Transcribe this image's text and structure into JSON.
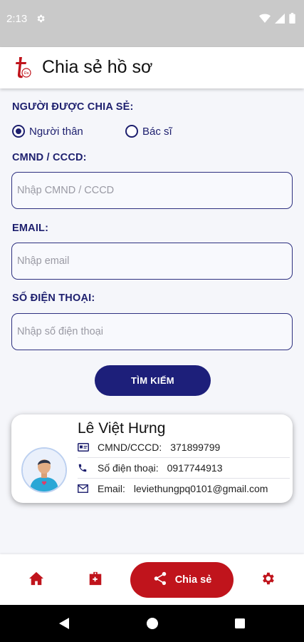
{
  "status_bar": {
    "time": "2:13"
  },
  "header": {
    "title": "Chia sẻ hồ sơ",
    "logo_icon": "hospital-t-logo-icon"
  },
  "form": {
    "share_with_label": "NGƯỜI ĐƯỢC CHIA SẺ:",
    "radio_options": [
      {
        "label": "Người thân",
        "checked": true
      },
      {
        "label": "Bác sĩ",
        "checked": false
      }
    ],
    "id_label": "CMND / CCCD:",
    "id_placeholder": "Nhập CMND / CCCD",
    "id_value": "",
    "email_label": "EMAIL:",
    "email_placeholder": "Nhập email",
    "email_value": "",
    "phone_label": "SỐ ĐIỆN THOẠI:",
    "phone_placeholder": "Nhập số điện thoại",
    "phone_value": "",
    "search_button": "TÌM KIẾM"
  },
  "result": {
    "name": "Lê Việt Hưng",
    "id_label": "CMND/CCCD:",
    "id_value": "371899799",
    "phone_label": "Số điện thoại:",
    "phone_value": "0917744913",
    "email_label": "Email:",
    "email_value": "leviethungpq0101@gmail.com"
  },
  "bottom_nav": {
    "items": [
      {
        "icon": "home-icon",
        "active": false
      },
      {
        "icon": "medical-record-icon",
        "active": false
      },
      {
        "icon": "share-icon",
        "label": "Chia sẻ",
        "active": true
      },
      {
        "icon": "settings-icon",
        "active": false
      }
    ]
  },
  "colors": {
    "primary": "#1d1f6e",
    "accent": "#c0141c",
    "status_bar": "#c9c9c9"
  }
}
